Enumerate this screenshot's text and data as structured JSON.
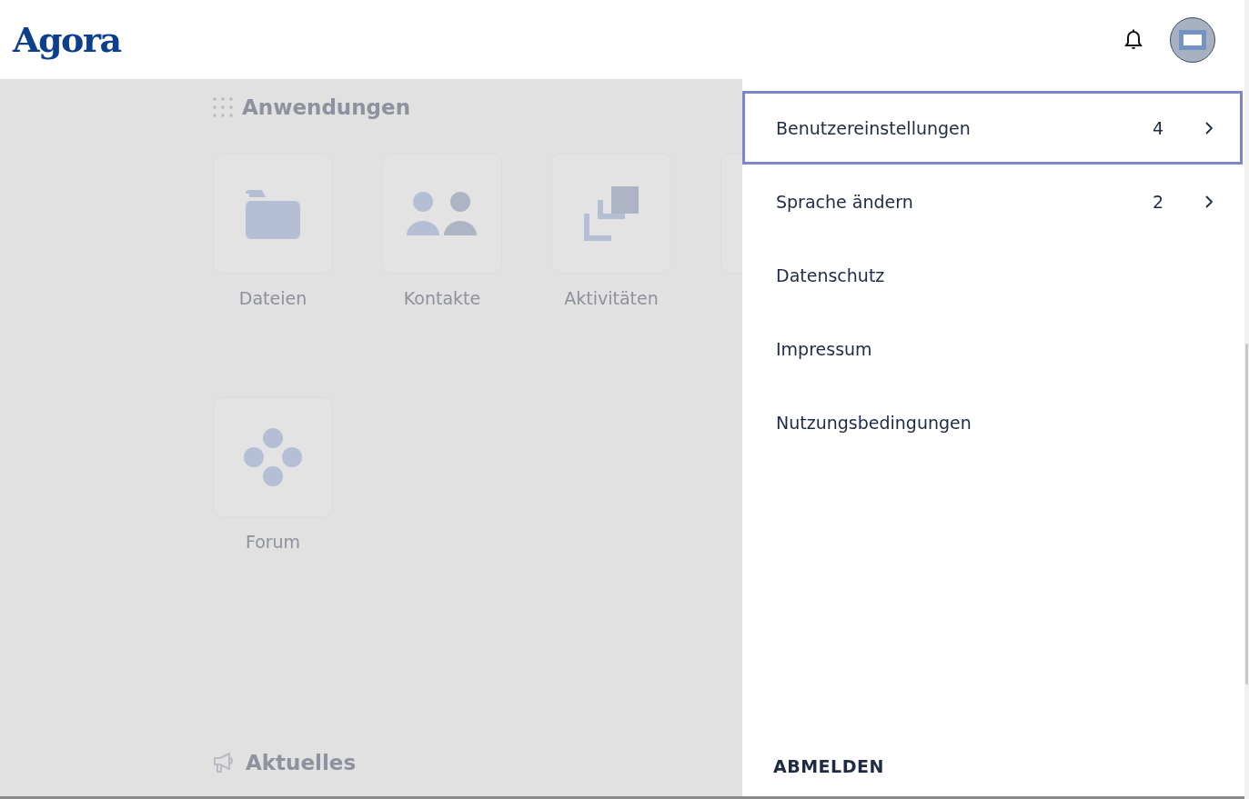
{
  "header": {
    "logo": "Agora"
  },
  "applications": {
    "heading": "Anwendungen",
    "apps": [
      {
        "label": "Dateien",
        "kind": "folder"
      },
      {
        "label": "Kontakte",
        "kind": "people"
      },
      {
        "label": "Aktivitäten",
        "kind": "stack"
      },
      {
        "label": "Forum",
        "kind": "dots"
      }
    ]
  },
  "news": {
    "heading": "Aktuelles"
  },
  "user_menu": {
    "items": [
      {
        "label": "Benutzereinstellungen",
        "count": "4",
        "submenu": true,
        "selected": true
      },
      {
        "label": "Sprache ändern",
        "count": "2",
        "submenu": true,
        "selected": false
      },
      {
        "label": "Datenschutz",
        "submenu": false,
        "selected": false
      },
      {
        "label": "Impressum",
        "submenu": false,
        "selected": false
      },
      {
        "label": "Nutzungsbedingungen",
        "submenu": false,
        "selected": false
      }
    ],
    "logout": "ABMELDEN"
  }
}
